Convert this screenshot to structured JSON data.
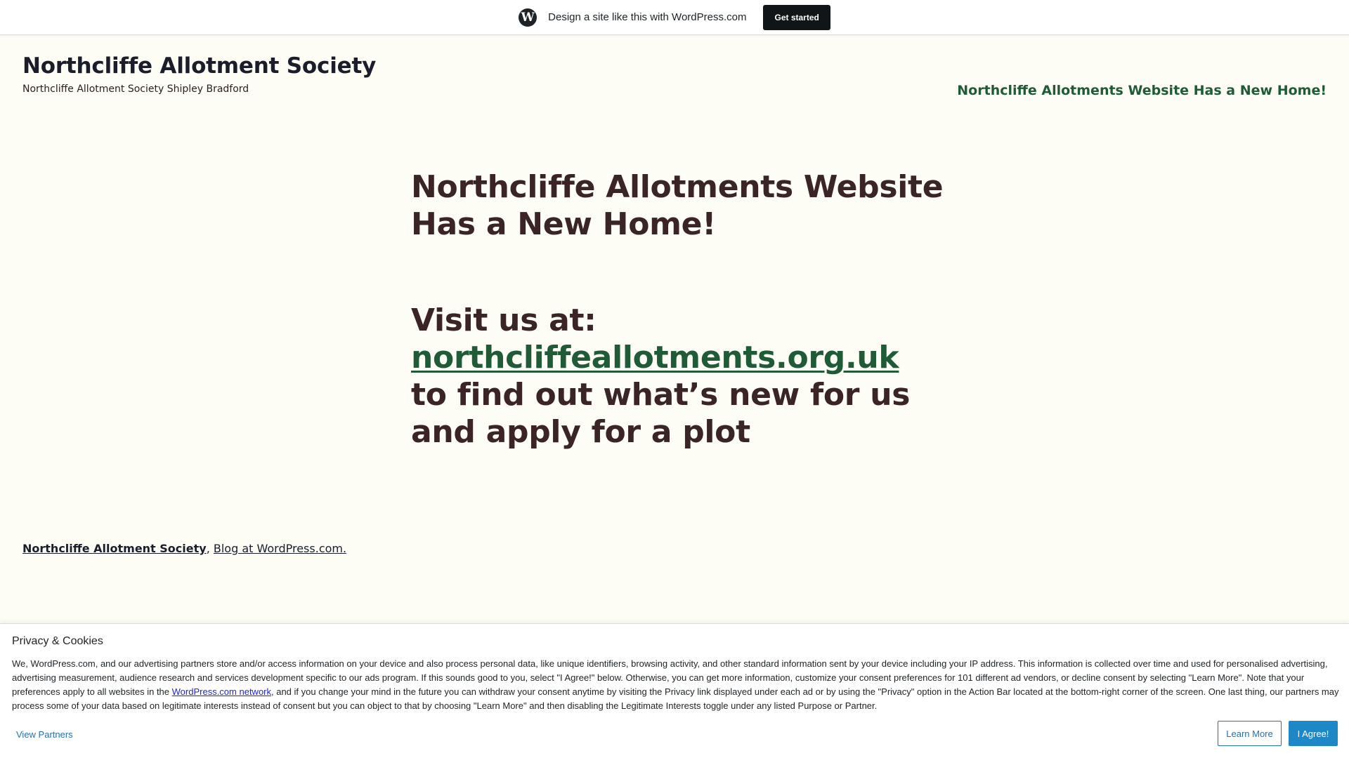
{
  "wp_bar": {
    "logo": "wordpress-logo",
    "promo_text": "Design a site like this with WordPress.com",
    "cta_label": "Get started"
  },
  "header": {
    "site_title": "Northcliffe Allotment Society",
    "tagline": "Northcliffe Allotment Society Shipley Bradford",
    "nav_link": "Northcliffe Allotments Website Has a New Home!"
  },
  "main": {
    "heading": "Northcliffe Allotments Website Has a New Home!",
    "visit_prefix": "Visit us at:",
    "visit_link": "northcliffeallotments.org.uk",
    "visit_suffix": "to find out what’s new for us and apply for a plot"
  },
  "footer": {
    "site_link": "Northcliffe Allotment Society",
    "separator": ",",
    "blog_link": "Blog at WordPress.com."
  },
  "cookie_banner": {
    "title": "Privacy & Cookies",
    "text_part1": "We, WordPress.com, and our advertising partners store and/or access information on your device and also process personal data, like unique identifiers, browsing activity, and other standard information sent by your device including your IP address. This information is collected over time and used for personalised advertising, advertising measurement, audience research and services development specific to our ads program. If this sounds good to you, select \"I Agree!\" below. Otherwise, you can get more information, customize your consent preferences for 101 different ad vendors, or decline consent by selecting \"Learn More\". Note that your preferences apply to all websites in the ",
    "network_link": "WordPress.com network",
    "text_part2": ", and if you change your mind in the future you can withdraw your consent anytime by visiting the Privacy link displayed under each ad or by using the \"Privacy\" option in the Action Bar located at the bottom-right corner of the screen. One last thing, our partners may process some of your data based on legitimate interests instead of consent but you can object to that by choosing \"Learn More\" and then disabling the Legitimate Interests toggle under any listed Purpose or Partner.",
    "view_partners": "View Partners",
    "learn_more": "Learn More",
    "agree": "I Agree!"
  },
  "colors": {
    "page_background": "#fdfcf5",
    "link_green": "#1f5b37",
    "heading_text": "#3a2426",
    "agree_button": "#1e88c7"
  }
}
